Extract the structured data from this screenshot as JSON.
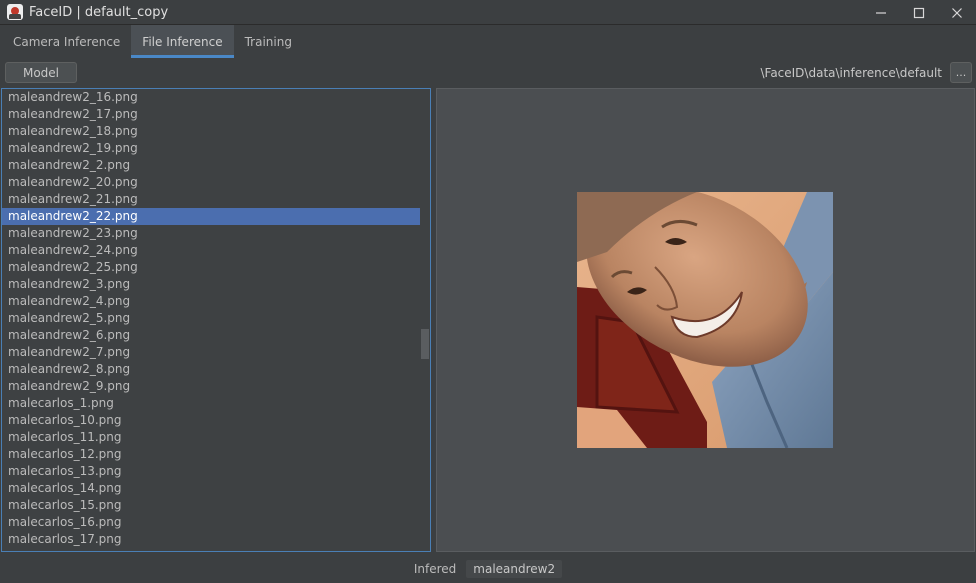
{
  "window": {
    "title": "FaceID | default_copy",
    "controls": [
      "minimize-icon",
      "maximize-icon",
      "close-icon"
    ]
  },
  "tabs": [
    {
      "label": "Camera Inference",
      "active": false
    },
    {
      "label": "File Inference",
      "active": true
    },
    {
      "label": "Training",
      "active": false
    }
  ],
  "toolbar": {
    "model_label": "Model",
    "path": "\\FaceID\\data\\inference\\default",
    "browse_label": "..."
  },
  "file_list": {
    "selected": "maleandrew2_22.png",
    "items": [
      "maleandrew2_16.png",
      "maleandrew2_17.png",
      "maleandrew2_18.png",
      "maleandrew2_19.png",
      "maleandrew2_2.png",
      "maleandrew2_20.png",
      "maleandrew2_21.png",
      "maleandrew2_22.png",
      "maleandrew2_23.png",
      "maleandrew2_24.png",
      "maleandrew2_25.png",
      "maleandrew2_3.png",
      "maleandrew2_4.png",
      "maleandrew2_5.png",
      "maleandrew2_6.png",
      "maleandrew2_7.png",
      "maleandrew2_8.png",
      "maleandrew2_9.png",
      "malecarlos_1.png",
      "malecarlos_10.png",
      "malecarlos_11.png",
      "malecarlos_12.png",
      "malecarlos_13.png",
      "malecarlos_14.png",
      "malecarlos_15.png",
      "malecarlos_16.png",
      "malecarlos_17.png"
    ]
  },
  "status": {
    "label": "Infered",
    "value": "maleandrew2"
  },
  "colors": {
    "accent": "#4a88c7",
    "selection": "#4b6eaf",
    "background": "#3c3f41"
  }
}
